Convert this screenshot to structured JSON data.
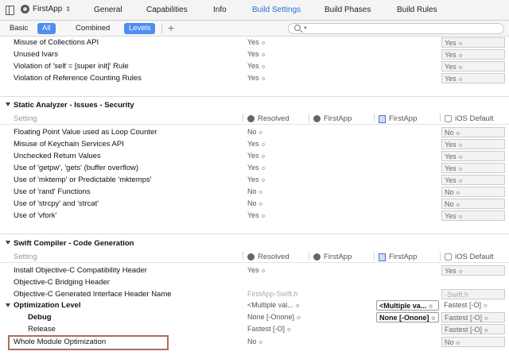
{
  "topbar": {
    "target_name": "FirstApp",
    "tabs": [
      "General",
      "Capabilities",
      "Info",
      "Build Settings",
      "Build Phases",
      "Build Rules"
    ],
    "active_tab": "Build Settings"
  },
  "filterbar": {
    "tabs": [
      "Basic",
      "All",
      "Combined",
      "Levels"
    ],
    "add_label": "+"
  },
  "columns": {
    "setting_label": "Setting",
    "resolved": "Resolved",
    "target": "FirstApp",
    "project": "FirstApp",
    "ios_default": "iOS Default"
  },
  "top_rows": [
    {
      "name": "Misuse of Collections API",
      "resolved": "Yes",
      "ios": "Yes"
    },
    {
      "name": "Unused Ivars",
      "resolved": "Yes",
      "ios": "Yes"
    },
    {
      "name": "Violation of 'self = [super init]' Rule",
      "resolved": "Yes",
      "ios": "Yes"
    },
    {
      "name": "Violation of Reference Counting Rules",
      "resolved": "Yes",
      "ios": "Yes"
    }
  ],
  "security": {
    "title": "Static Analyzer - Issues - Security",
    "rows": [
      {
        "name": "Floating Point Value used as Loop Counter",
        "resolved": "No",
        "ios": "No"
      },
      {
        "name": "Misuse of Keychain Services API",
        "resolved": "Yes",
        "ios": "Yes"
      },
      {
        "name": "Unchecked Return Values",
        "resolved": "Yes",
        "ios": "Yes"
      },
      {
        "name": "Use of 'getpw', 'gets' (buffer overflow)",
        "resolved": "Yes",
        "ios": "Yes"
      },
      {
        "name": "Use of 'mktemp' or Predictable 'mktemps'",
        "resolved": "Yes",
        "ios": "Yes"
      },
      {
        "name": "Use of 'rand' Functions",
        "resolved": "No",
        "ios": "No"
      },
      {
        "name": "Use of 'strcpy' and 'strcat'",
        "resolved": "No",
        "ios": "No"
      },
      {
        "name": "Use of 'vfork'",
        "resolved": "Yes",
        "ios": "Yes"
      }
    ]
  },
  "swift": {
    "title": "Swift Compiler - Code Generation",
    "rows": {
      "compat_header": {
        "name": "Install Objective-C Compatibility Header",
        "resolved": "Yes",
        "ios": "Yes"
      },
      "bridging": {
        "name": "Objective-C Bridging Header"
      },
      "generated": {
        "name": "Objective-C Generated Interface Header Name",
        "resolved": "FirstApp-Swift.h",
        "ios": "-Swift.h"
      },
      "opt_level": {
        "name": "Optimization Level",
        "resolved": "<Multiple val...",
        "target": "<Multiple va...",
        "ios": "Fastest [-O]"
      },
      "debug": {
        "name": "Debug",
        "resolved": "None [-Onone]",
        "target": "None [-Onone]",
        "ios": "Fastest [-O]"
      },
      "release": {
        "name": "Release",
        "resolved": "Fastest [-O]",
        "ios": "Fastest [-O]"
      },
      "wmo": {
        "name": "Whole Module Optimization",
        "resolved": "No",
        "ios": "No"
      }
    }
  },
  "icons": {
    "updown": "⌃⌄",
    "stepper": "≎"
  }
}
